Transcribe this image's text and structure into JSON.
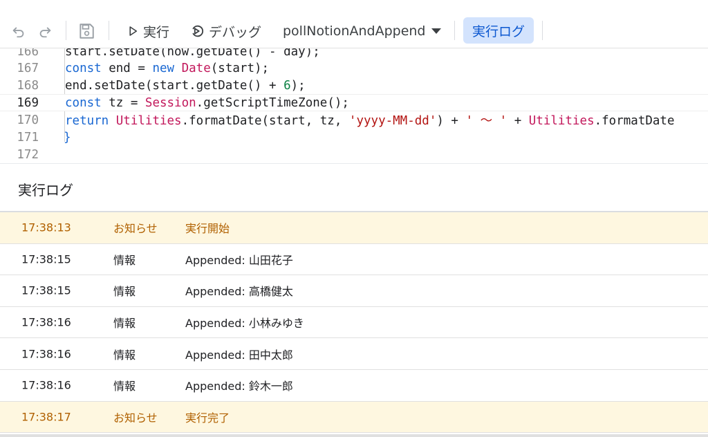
{
  "toolbar": {
    "run_label": "実行",
    "debug_label": "デバッグ",
    "function_name": "pollNotionAndAppend",
    "log_toggle_label": "実行ログ"
  },
  "editor": {
    "lines": [
      {
        "number": "166",
        "text": "start.setDate(now.getDate() - day);"
      },
      {
        "number": "167",
        "text": "const end = new Date(start);"
      },
      {
        "number": "168",
        "text": "end.setDate(start.getDate() + 6);"
      },
      {
        "number": "169",
        "text": "const tz = Session.getScriptTimeZone();"
      },
      {
        "number": "170",
        "text": "return Utilities.formatDate(start, tz, 'yyyy-MM-dd') + ' ～ ' + Utilities.formatDate"
      },
      {
        "number": "171",
        "text": "}"
      },
      {
        "number": "172",
        "text": ""
      }
    ]
  },
  "log": {
    "title": "実行ログ",
    "rows": [
      {
        "time": "17:38:13",
        "level": "お知らせ",
        "message": "実行開始"
      },
      {
        "time": "17:38:15",
        "level": "情報",
        "message": "Appended: 山田花子"
      },
      {
        "time": "17:38:15",
        "level": "情報",
        "message": "Appended: 高橋健太"
      },
      {
        "time": "17:38:16",
        "level": "情報",
        "message": "Appended: 小林みゆき"
      },
      {
        "time": "17:38:16",
        "level": "情報",
        "message": "Appended: 田中太郎"
      },
      {
        "time": "17:38:16",
        "level": "情報",
        "message": "Appended: 鈴木一郎"
      },
      {
        "time": "17:38:17",
        "level": "お知らせ",
        "message": "実行完了"
      }
    ]
  },
  "icons": {
    "undo": "undo-icon",
    "redo": "redo-icon",
    "save": "save-icon",
    "run": "play-icon",
    "debug": "debug-icon",
    "dropdown": "caret-down-icon"
  },
  "colors": {
    "accent": "#0b57d0",
    "accent_bg": "#d3e3fd",
    "notice_bg": "#fef7e0",
    "notice_text": "#b06000"
  }
}
